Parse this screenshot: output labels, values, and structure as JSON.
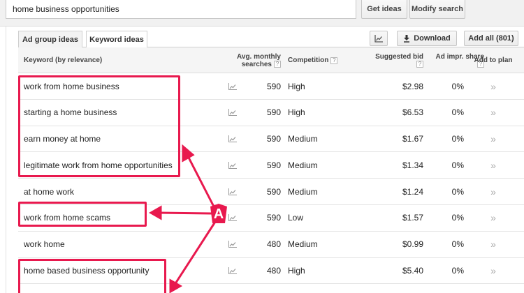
{
  "search": {
    "value": "home business opportunities"
  },
  "toolbar": {
    "get_ideas": "Get ideas",
    "modify_search": "Modify search"
  },
  "tabs": [
    {
      "label": "Ad group ideas",
      "active": false
    },
    {
      "label": "Keyword ideas",
      "active": true
    }
  ],
  "actions": {
    "download": "Download",
    "add_all": "Add all (801)",
    "chart_icon": "chart-icon"
  },
  "columns": {
    "keyword": "Keyword (by relevance)",
    "avg_line1": "Avg. monthly",
    "avg_line2": "searches",
    "competition": "Competition",
    "bid_line1": "Suggested bid",
    "share_line1": "Ad impr. share",
    "add_to_plan": "Add to plan",
    "help": "?"
  },
  "rows": [
    {
      "keyword": "work from home business",
      "searches": "590",
      "competition": "High",
      "bid": "$2.98",
      "share": "0%",
      "add": "»"
    },
    {
      "keyword": "starting a home business",
      "searches": "590",
      "competition": "High",
      "bid": "$6.53",
      "share": "0%",
      "add": "»"
    },
    {
      "keyword": "earn money at home",
      "searches": "590",
      "competition": "Medium",
      "bid": "$1.67",
      "share": "0%",
      "add": "»"
    },
    {
      "keyword": "legitimate work from home opportunities",
      "searches": "590",
      "competition": "Medium",
      "bid": "$1.34",
      "share": "0%",
      "add": "»"
    },
    {
      "keyword": "at home work",
      "searches": "590",
      "competition": "Medium",
      "bid": "$1.24",
      "share": "0%",
      "add": "»"
    },
    {
      "keyword": "work from home scams",
      "searches": "590",
      "competition": "Low",
      "bid": "$1.57",
      "share": "0%",
      "add": "»"
    },
    {
      "keyword": "work home",
      "searches": "480",
      "competition": "Medium",
      "bid": "$0.99",
      "share": "0%",
      "add": "»"
    },
    {
      "keyword": "home based business opportunity",
      "searches": "480",
      "competition": "High",
      "bid": "$5.40",
      "share": "0%",
      "add": "»"
    }
  ],
  "annotation": {
    "label": "A",
    "color": "#e8194e"
  }
}
